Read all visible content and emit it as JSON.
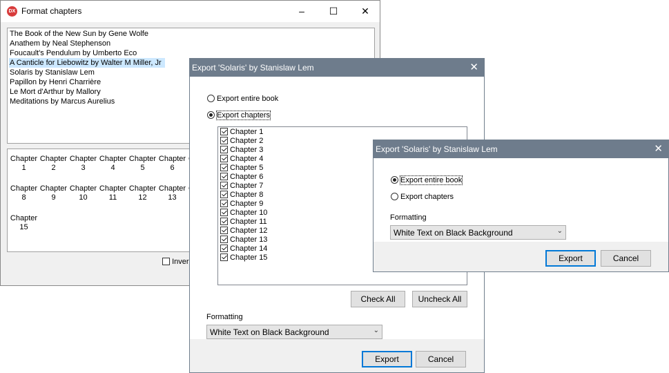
{
  "main": {
    "title": "Format chapters",
    "app_icon_text": "DX",
    "books": [
      "The Book of the New Sun by Gene Wolfe",
      "Anathem by Neal Stephenson",
      "Foucault's Pendulum by Umberto Eco",
      "A Canticle for Liebowitz by Walter M Miller, Jr",
      "Solaris by Stanislaw Lem",
      "Papillon by Henri Charrière",
      "Le Mort d'Arthur by Mallory",
      "Meditations by Marcus Aurelius"
    ],
    "selected_book_index": 3,
    "chapter_grid": {
      "word": "Chapter",
      "numbers": [
        "1",
        "2",
        "3",
        "4",
        "5",
        "6",
        "8",
        "9",
        "10",
        "11",
        "12",
        "13",
        "15"
      ],
      "partial_cells": [
        "C",
        "C"
      ]
    },
    "invert_label": "Inver"
  },
  "dialog1": {
    "title": "Export 'Solaris' by Stanislaw Lem",
    "radio_entire": "Export entire book",
    "radio_chapters": "Export chapters",
    "selected": "chapters",
    "chapters": [
      "Chapter 1",
      "Chapter 2",
      "Chapter 3",
      "Chapter 4",
      "Chapter 5",
      "Chapter 6",
      "Chapter 7",
      "Chapter 8",
      "Chapter 9",
      "Chapter 10",
      "Chapter 11",
      "Chapter 12",
      "Chapter 13",
      "Chapter 14",
      "Chapter 15"
    ],
    "check_all": "Check All",
    "uncheck_all": "Uncheck All",
    "formatting_label": "Formatting",
    "formatting_value": "White Text on Black Background",
    "export": "Export",
    "cancel": "Cancel"
  },
  "dialog2": {
    "title": "Export 'Solaris' by Stanislaw Lem",
    "radio_entire": "Export entire book",
    "radio_chapters": "Export chapters",
    "selected": "entire",
    "formatting_label": "Formatting",
    "formatting_value": "White Text on Black Background",
    "export": "Export",
    "cancel": "Cancel"
  },
  "colors": {
    "dialog_titlebar": "#6e7c8c",
    "selection": "#cce8ff",
    "default_button_border": "#0078d7"
  }
}
